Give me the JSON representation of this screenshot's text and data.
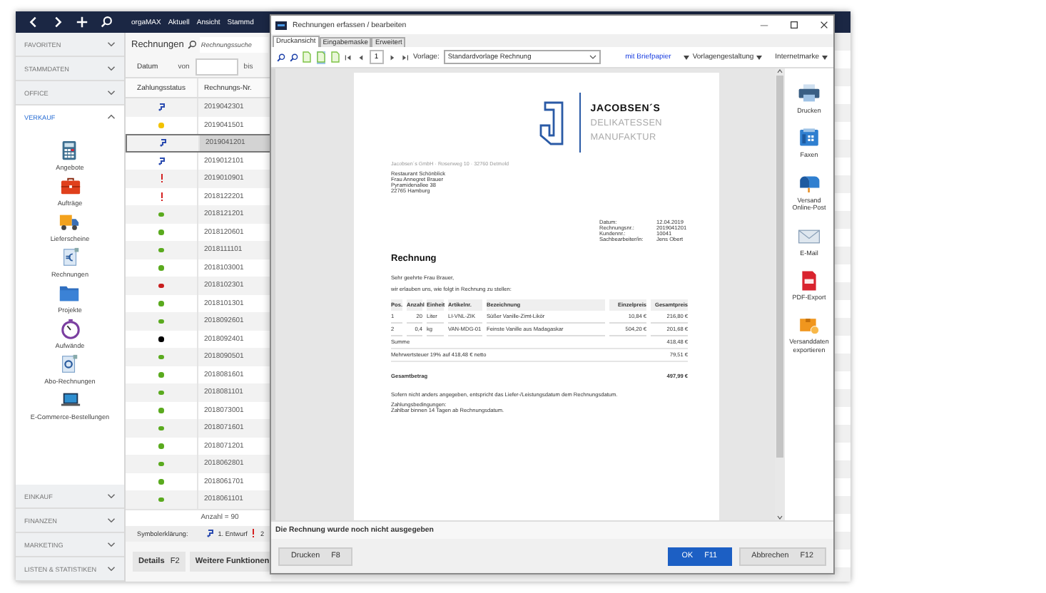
{
  "app_bar": {
    "menu": [
      "orgaMAX",
      "Aktuell",
      "Ansicht",
      "Stammd"
    ]
  },
  "sidebar": {
    "sections": [
      {
        "label": "FAVORITEN",
        "expanded": false
      },
      {
        "label": "STAMMDATEN",
        "expanded": false
      },
      {
        "label": "OFFICE",
        "expanded": false
      },
      {
        "label": "VERKAUF",
        "expanded": true,
        "items": [
          "Angebote",
          "Aufträge",
          "Lieferscheine",
          "Rechnungen",
          "Projekte",
          "Aufwände",
          "Abo-Rechnungen",
          "E-Commerce-Bestellungen"
        ]
      },
      {
        "label": "EINKAUF",
        "expanded": false
      },
      {
        "label": "FINANZEN",
        "expanded": false
      },
      {
        "label": "MARKETING",
        "expanded": false
      },
      {
        "label": "LISTEN & STATISTIKEN",
        "expanded": false
      }
    ]
  },
  "list": {
    "title": "Rechnungen",
    "search": {
      "placeholder": "Rechnungssuche"
    },
    "date_filter": {
      "label": "Datum",
      "from_label": "von",
      "to_label": "bis"
    },
    "columns": [
      "Zahlungsstatus",
      "Rechnungs-Nr."
    ],
    "rows": [
      {
        "kind": "draft",
        "number": "2019042301",
        "selected": false
      },
      {
        "kind": "dot",
        "color": "#f2c200",
        "number": "2019041501",
        "selected": false
      },
      {
        "kind": "draft",
        "number": "2019041201",
        "selected": true
      },
      {
        "kind": "draft",
        "number": "2019012101",
        "selected": false
      },
      {
        "kind": "overdue",
        "number": "2019010901",
        "selected": false
      },
      {
        "kind": "overdue",
        "number": "2018122201",
        "selected": false
      },
      {
        "kind": "dot",
        "color": "#5aaa1e",
        "number": "2018121201",
        "selected": false
      },
      {
        "kind": "dot",
        "color": "#5aaa1e",
        "number": "2018120601",
        "selected": false
      },
      {
        "kind": "dot",
        "color": "#5aaa1e",
        "number": "2018111101",
        "selected": false
      },
      {
        "kind": "dot",
        "color": "#5aaa1e",
        "number": "2018103001",
        "selected": false
      },
      {
        "kind": "dot",
        "color": "#c81e1e",
        "number": "2018102301",
        "selected": false
      },
      {
        "kind": "dot",
        "color": "#5aaa1e",
        "number": "2018101301",
        "selected": false
      },
      {
        "kind": "dot",
        "color": "#5aaa1e",
        "number": "2018092601",
        "selected": false
      },
      {
        "kind": "dot",
        "color": "#000000",
        "number": "2018092401",
        "selected": false
      },
      {
        "kind": "dot",
        "color": "#5aaa1e",
        "number": "2018090501",
        "selected": false
      },
      {
        "kind": "dot",
        "color": "#5aaa1e",
        "number": "2018081601",
        "selected": false
      },
      {
        "kind": "dot",
        "color": "#5aaa1e",
        "number": "2018081101",
        "selected": false
      },
      {
        "kind": "dot",
        "color": "#5aaa1e",
        "number": "2018073001",
        "selected": false
      },
      {
        "kind": "dot",
        "color": "#5aaa1e",
        "number": "2018071601",
        "selected": false
      },
      {
        "kind": "dot",
        "color": "#5aaa1e",
        "number": "2018071201",
        "selected": false
      },
      {
        "kind": "dot",
        "color": "#5aaa1e",
        "number": "2018062801",
        "selected": false
      },
      {
        "kind": "dot",
        "color": "#5aaa1e",
        "number": "2018061701",
        "selected": false
      },
      {
        "kind": "dot",
        "color": "#5aaa1e",
        "number": "2018061101",
        "selected": false
      }
    ],
    "count": "Anzahl = 90",
    "legend": {
      "label": "Symbolerklärung:",
      "entries": [
        {
          "kind": "draft",
          "label": "1. Entwurf"
        },
        {
          "kind": "overdue",
          "label": "2"
        }
      ]
    },
    "buttons": [
      {
        "label": "Details",
        "key": "F2"
      },
      {
        "label": "Weitere Funktionen"
      }
    ]
  },
  "dialog": {
    "title": "Rechnungen erfassen / bearbeiten",
    "tabs": [
      {
        "label": "Druckansicht",
        "selected": true
      },
      {
        "label": "Eingabemaske",
        "selected": false
      },
      {
        "label": "Erweitert",
        "selected": false
      }
    ],
    "toolbar": {
      "view_buttons": [
        {
          "selected": false
        },
        {
          "selected": true
        },
        {
          "selected": false
        }
      ],
      "page": "1",
      "template_label": "Vorlage:",
      "template": "Standardvorlage Rechnung",
      "letterhead_link": "mit Briefpapier",
      "menus": [
        "Vorlagengestaltung",
        "Internetmarke"
      ]
    },
    "document": {
      "logo": [
        "JACOBSEN´S",
        "DELIKATESSEN",
        "MANUFAKTUR"
      ],
      "sender": "Jacobsen´s GmbH · Rosenweg 10 · 32760 Detmold",
      "address": [
        "Restaurant Schönblick",
        "Frau Annegret Brauer",
        "Pyramidenallee 38",
        "22765 Hamburg"
      ],
      "info": [
        [
          "Datum:",
          "12.04.2019"
        ],
        [
          "Rechnungsnr.:",
          "2019041201"
        ],
        [
          "Kundennr.:",
          "10041"
        ],
        [
          "Sachbearbeiter/in:",
          "Jens Obert"
        ]
      ],
      "heading": "Rechnung",
      "salutation": "Sehr geehrte Frau Brauer,",
      "intro": "wir erlauben uns, wie folgt in Rechnung zu stellen:",
      "columns": [
        "Pos.",
        "Anzahl",
        "Einheit",
        "Artikelnr.",
        "Bezeichnung",
        "Einzelpreis",
        "Gesamtpreis"
      ],
      "rows": [
        [
          "1",
          "20",
          "Liter",
          "LI-VNL-ZIK",
          "Süßer Vanille-Zimt-Likör",
          "10,84 €",
          "216,80 €"
        ],
        [
          "2",
          "0,4",
          "kg",
          "VAN-MDG-01",
          "Feinste Vanille aus Madagaskar",
          "504,20 €",
          "201,68 €"
        ]
      ],
      "totals": [
        {
          "label": "Summe",
          "value": "418,48 €",
          "bold": false
        },
        {
          "label": "Mehrwertsteuer 19% auf 418,48 € netto",
          "value": "79,51 €",
          "bold": false
        },
        {
          "label": "Gesamtbetrag",
          "value": "497,99 €",
          "bold": true
        }
      ],
      "note": "Sofern nicht anders angegeben, entspricht das Liefer-/Leistungsdatum dem Rechnungsdatum.",
      "terms": [
        "Zahlungsbedingungen:",
        "Zahlbar binnen 14 Tagen ab Rechnungsdatum."
      ]
    },
    "actions": [
      "Drucken",
      "Faxen",
      "Versand Online-Post",
      "E-Mail",
      "PDF-Export",
      "Versanddaten exportieren"
    ],
    "status_message": "Die Rechnung wurde noch nicht ausgegeben",
    "buttons": [
      {
        "label": "Drucken",
        "key": "F8",
        "kind": "plain"
      },
      {
        "label": "OK",
        "key": "F11",
        "kind": "primary"
      },
      {
        "label": "Abbrechen",
        "key": "F12",
        "kind": "default"
      }
    ]
  }
}
